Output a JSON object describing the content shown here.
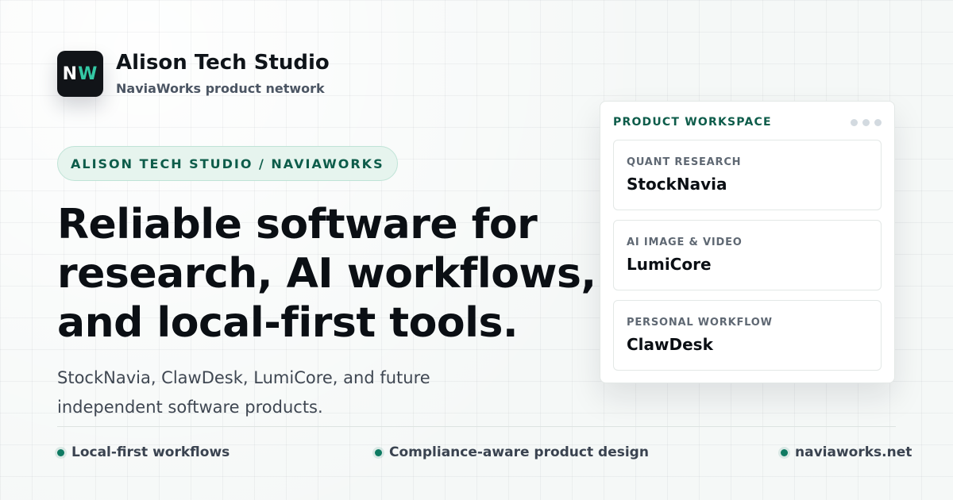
{
  "brand": {
    "logo_part1": "N",
    "logo_part2": "W",
    "title": "Alison Tech Studio",
    "subtitle": "NaviaWorks product network"
  },
  "pill": {
    "label": "ALISON TECH STUDIO / NAVIAWORKS"
  },
  "headline": {
    "line1": "Reliable software for",
    "line2": "research, AI workflows,",
    "line3": "and local-first tools."
  },
  "subtext": {
    "line1": "StockNavia, ClawDesk, LumiCore, and future",
    "line2": "independent software products."
  },
  "features": [
    {
      "label": "Local-first workflows"
    },
    {
      "label": "Compliance-aware product design"
    },
    {
      "label": "naviaworks.net"
    }
  ],
  "workspace": {
    "title": "PRODUCT WORKSPACE",
    "items": [
      {
        "tag": "QUANT RESEARCH",
        "name": "StockNavia"
      },
      {
        "tag": "AI IMAGE & VIDEO",
        "name": "LumiCore"
      },
      {
        "tag": "PERSONAL WORKFLOW",
        "name": "ClawDesk"
      }
    ]
  },
  "colors": {
    "accent": "#0d5c4a",
    "logo_accent": "#34c8a4",
    "dot": "#0e7a62"
  }
}
